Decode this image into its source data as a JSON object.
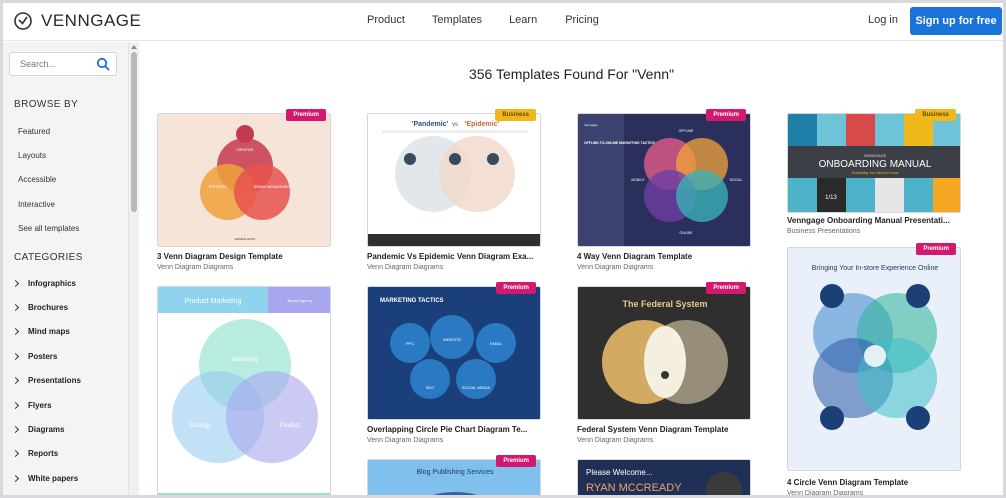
{
  "header": {
    "brand": "VENNGAGE",
    "nav": [
      "Product",
      "Templates",
      "Learn",
      "Pricing"
    ],
    "login": "Log in",
    "signup": "Sign up for free"
  },
  "sidebar": {
    "search_placeholder": "Search...",
    "browse_title": "BROWSE BY",
    "browse_items": [
      "Featured",
      "Layouts",
      "Accessible",
      "Interactive",
      "See all templates"
    ],
    "categories_title": "CATEGORIES",
    "categories": [
      "Infographics",
      "Brochures",
      "Mind maps",
      "Posters",
      "Presentations",
      "Flyers",
      "Diagrams",
      "Reports",
      "White papers"
    ]
  },
  "main": {
    "results_title": "356 Templates Found For \"Venn\"",
    "cards": [
      {
        "title": "3 Venn Diagram Design Template",
        "category": "Venn Diagram Diagrams",
        "badge": "Premium"
      },
      {
        "title": "Pandemic Vs Epidemic Venn Diagram Exa...",
        "category": "Venn Diagram Diagrams",
        "badge": "Business"
      },
      {
        "title": "4 Way Venn Diagram Template",
        "category": "Venn Diagram Diagrams",
        "badge": "Premium"
      },
      {
        "title": "Venngage Onboarding Manual Presentati...",
        "category": "Business Presentations",
        "badge": "Business"
      },
      {
        "title": "Overlapping Circle Pie Chart Diagram Te...",
        "category": "Venn Diagram Diagrams",
        "badge": "Premium"
      },
      {
        "title": "Federal System Venn Diagram Template",
        "category": "Venn Diagram Diagrams",
        "badge": "Premium"
      },
      {
        "title": "4 Circle Venn Diagram Template",
        "category": "Venn Diagram Diagrams",
        "badge": "Premium"
      },
      {
        "title": "",
        "category": "",
        "badge": ""
      },
      {
        "title": "",
        "category": "",
        "badge": "Premium"
      },
      {
        "title": "",
        "category": "",
        "badge": ""
      }
    ],
    "thumb_text": {
      "c1_labels": [
        "CREATIVE",
        "STRATEGY",
        "BRAND MANAGEMENT",
        "DESIGN HOST"
      ],
      "c2_title_a": "'Pandemic'",
      "c2_vs": "vs",
      "c2_title_b": "'Epidemic'",
      "c3_heading": "OFFLINE-TO-ONLINE MARKETING TACTICS",
      "c3_top": "Venngage",
      "c3_labels": [
        "OFFLINE",
        "ONLINE",
        "MOBILE",
        "SOCIAL"
      ],
      "c4_brand": "VENNGAGE",
      "c4_title": "ONBOARDING MANUAL",
      "c4_sub": "Everything You Need to Know",
      "c4_page": "1/13",
      "c5_header": "Product Marketing",
      "c5_header2": "Brand Agency",
      "c5_labels": [
        "Marketing",
        "Strategy",
        "Product"
      ],
      "c6_title": "MARKETING TACTICS",
      "c6_labels": [
        "PPC",
        "WEBSITE",
        "EMAIL",
        "SEO",
        "SOCIAL MEDIA"
      ],
      "c7_title": "The Federal System",
      "c8_title": "Bringing Your In-store Experience Online",
      "c9_title": "Blog Publishing Services",
      "c10_title_a": "Please Welcome...",
      "c10_title_b": "RYAN MCCREADY"
    }
  }
}
